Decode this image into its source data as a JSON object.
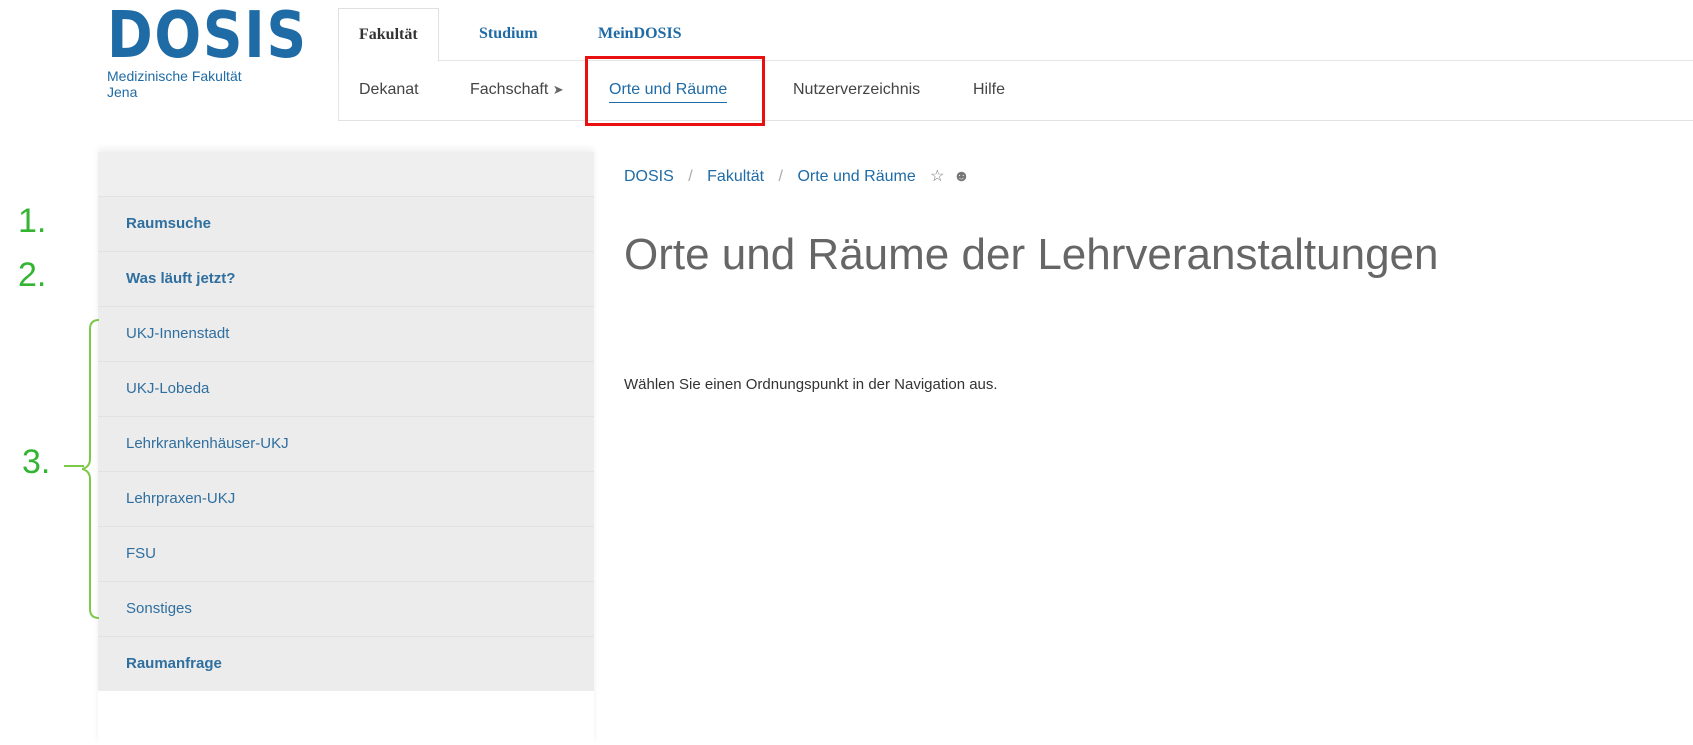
{
  "logo": {
    "word": "DOSIS",
    "subtitle_line1": "Medizinische Fakultät",
    "subtitle_line2": "Jena"
  },
  "top_tabs": [
    {
      "label": "Fakultät",
      "active": true
    },
    {
      "label": "Studium",
      "active": false
    },
    {
      "label": "MeinDOSIS",
      "active": false
    }
  ],
  "sub_nav": [
    {
      "label": "Dekanat"
    },
    {
      "label": "Fachschaft",
      "icon": "external-arrow-icon"
    },
    {
      "label": "Orte und Räume",
      "current": true
    },
    {
      "label": "Nutzerverzeichnis"
    },
    {
      "label": "Hilfe"
    }
  ],
  "breadcrumb": {
    "items": [
      "DOSIS",
      "Fakultät",
      "Orte und Räume"
    ],
    "separator": "/",
    "star_icon": "star-icon",
    "user_icon": "user-icon"
  },
  "sidebar": {
    "items": [
      {
        "label": "Raumsuche",
        "bold": true
      },
      {
        "label": "Was läuft jetzt?",
        "bold": true
      },
      {
        "label": "UKJ-Innenstadt",
        "bold": false
      },
      {
        "label": "UKJ-Lobeda",
        "bold": false
      },
      {
        "label": "Lehrkrankenhäuser-UKJ",
        "bold": false
      },
      {
        "label": "Lehrpraxen-UKJ",
        "bold": false
      },
      {
        "label": "FSU",
        "bold": false
      },
      {
        "label": "Sonstiges",
        "bold": false
      },
      {
        "label": "Raumanfrage",
        "bold": true
      }
    ]
  },
  "main": {
    "title": "Orte und Räume der Lehrveranstaltungen",
    "hint": "Wählen Sie einen Ordnungspunkt in der Navigation aus."
  },
  "annotations": {
    "one": "1.",
    "two": "2.",
    "three": "3."
  },
  "colors": {
    "brand": "#1f6ba5",
    "annotation": "#33b533",
    "highlight": "#e81010"
  }
}
